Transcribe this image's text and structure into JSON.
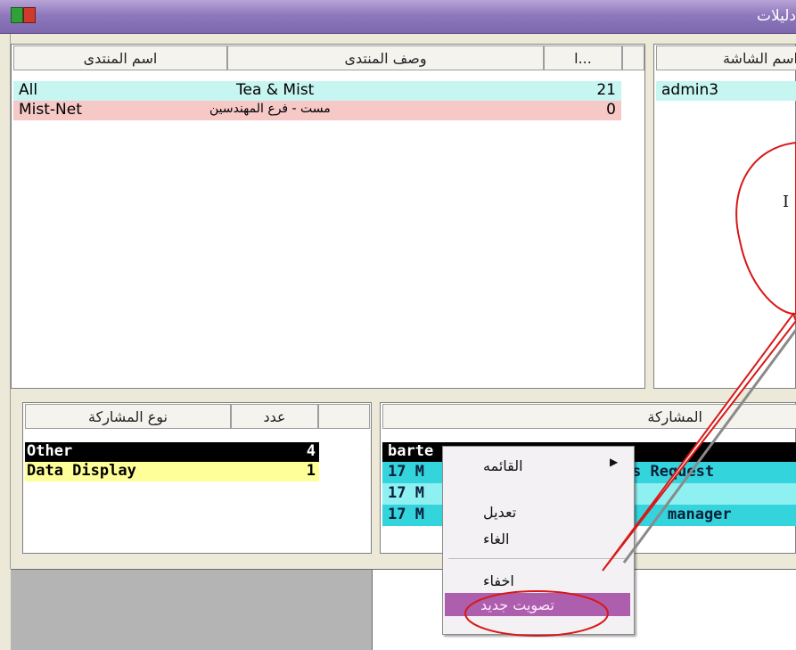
{
  "window": {
    "title": "دليلات"
  },
  "forums_table": {
    "headers": {
      "name": "اسم المنتدى",
      "description": "وصف المنتدى",
      "count": "ا..."
    },
    "rows": [
      {
        "name": "All",
        "description": "Tea & Mist",
        "count": "21",
        "color": "#c6f5f2"
      },
      {
        "name": "Mist-Net",
        "description": "مست - فرع المهندسين",
        "count": "0",
        "color": "#f6c8c6"
      }
    ]
  },
  "screen_table": {
    "header": "اسم الشاشة",
    "rows": [
      {
        "value": "admin3"
      }
    ]
  },
  "participation_types": {
    "headers": {
      "type": "نوع المشاركة",
      "count": "عدد"
    },
    "rows": [
      {
        "type": "Other",
        "count": "4",
        "bg": "#000000",
        "fg": "#ffffff"
      },
      {
        "type": "Data Display",
        "count": "1",
        "bg": "#ffff99",
        "fg": "#000000"
      }
    ]
  },
  "participations": {
    "header": "المشاركة",
    "rows": [
      {
        "left": "barte",
        "right": "",
        "bg": "#000000",
        "fg": "#ffffff"
      },
      {
        "left": "17 M",
        "right": "s Request",
        "bg": "#33d4dc",
        "fg": "#0b1f3a"
      },
      {
        "left": "17 M",
        "right": "",
        "bg": "#8ff0f2",
        "fg": "#0b1f3a"
      },
      {
        "left": "17 M",
        "right": "manager",
        "bg": "#33d4dc",
        "fg": "#0b1f3a"
      }
    ]
  },
  "context_menu": {
    "items": [
      {
        "label": "القائمه",
        "submenu": true
      },
      {
        "label": "تعديل"
      },
      {
        "label": "الغاء"
      },
      {
        "label": "اخفاء"
      },
      {
        "label": "تصويت جديد",
        "highlighted": true
      }
    ]
  },
  "annotation": {
    "callout_text": "I"
  }
}
